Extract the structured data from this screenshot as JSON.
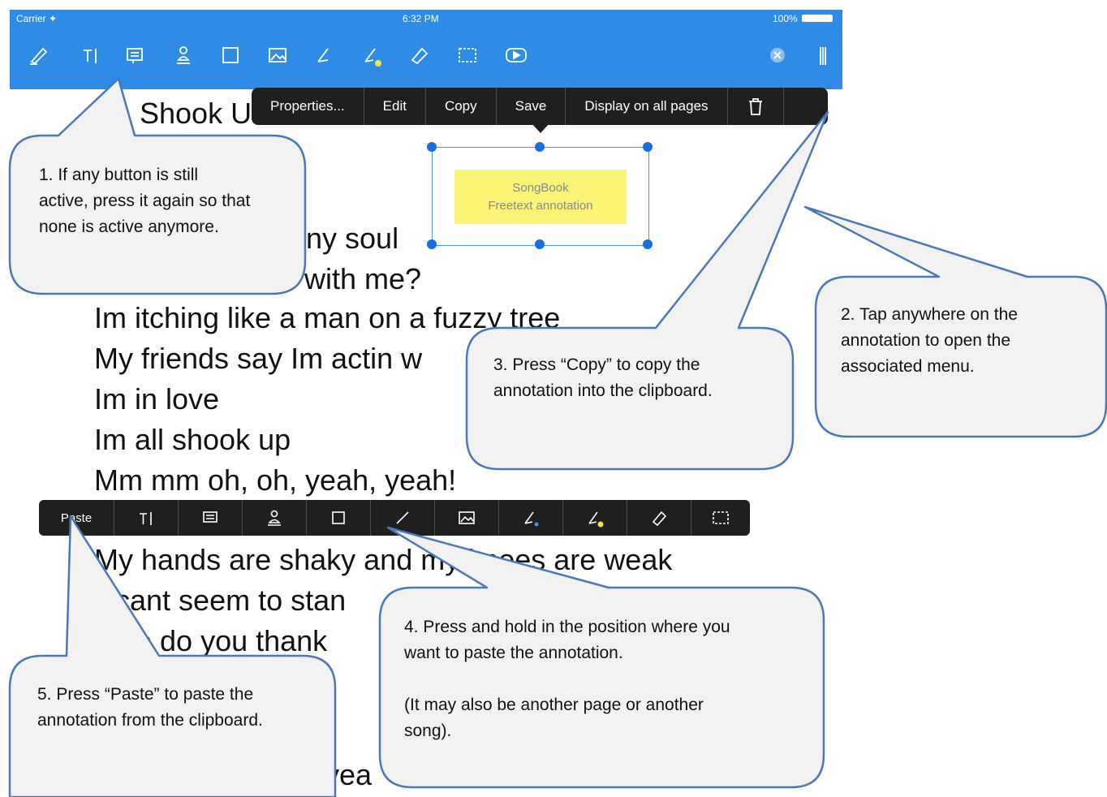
{
  "statusbar": {
    "carrier": "Carrier ✦",
    "time": "6:32 PM",
    "battery": "100%"
  },
  "toolbar": {
    "icons": [
      "pen-icon",
      "text-icon",
      "note-icon",
      "stamp-icon",
      "rectangle-icon",
      "image-icon",
      "pen-blue-icon",
      "pen-yellow-icon",
      "eraser-icon",
      "selection-icon",
      "play-icon"
    ],
    "close_icon": "close-icon",
    "menu_icon": "menu-icon"
  },
  "lyrics": {
    "title": "Shook U",
    "line1": "ny soul",
    "line2": "with me?",
    "line3": "Im itching like a man on a fuzzy tree",
    "line4": "My friends say Im actin w",
    "line5": "Im in love",
    "line6": "Im all shook up",
    "line7": "Mm mm oh, oh, yeah, yeah!",
    "line8": "My hands are shaky and my knees are weak",
    "line9": "cant seem to stan",
    "line10": "o do you thank",
    "line11": "yea"
  },
  "context_menu": {
    "properties": "Properties...",
    "edit": "Edit",
    "copy": "Copy",
    "save": "Save",
    "display_all": "Display on all pages",
    "trash_icon": "trash-icon"
  },
  "annotation": {
    "line1": "SongBook",
    "line2": "Freetext annotation"
  },
  "paste_bar": {
    "paste": "Paste",
    "icons": [
      "text-icon",
      "note-icon",
      "stamp-icon",
      "rectangle-icon",
      "line-icon",
      "image-icon",
      "pen-blue-icon",
      "pen-yellow-icon",
      "eraser-icon",
      "selection-icon"
    ]
  },
  "callouts": {
    "c1": "1. If any button is still\nactive, press it again so that\nnone is active anymore.",
    "c2": "2. Tap anywhere on the\nannotation to open the\nassociated menu.",
    "c3": "3. Press “Copy” to copy the\nannotation into the clipboard.",
    "c4": "4. Press and hold in the position where you\nwant to paste the annotation.\n\n(It may also be another page or another\nsong).",
    "c5": "5. Press “Paste” to paste the\nannotation from the clipboard."
  },
  "colors": {
    "bar": "#2e8be6",
    "callout_fill": "#f2f2f2",
    "callout_stroke": "#4a78b8",
    "menu": "#1f1f1f",
    "annotation": "#fbf476"
  }
}
